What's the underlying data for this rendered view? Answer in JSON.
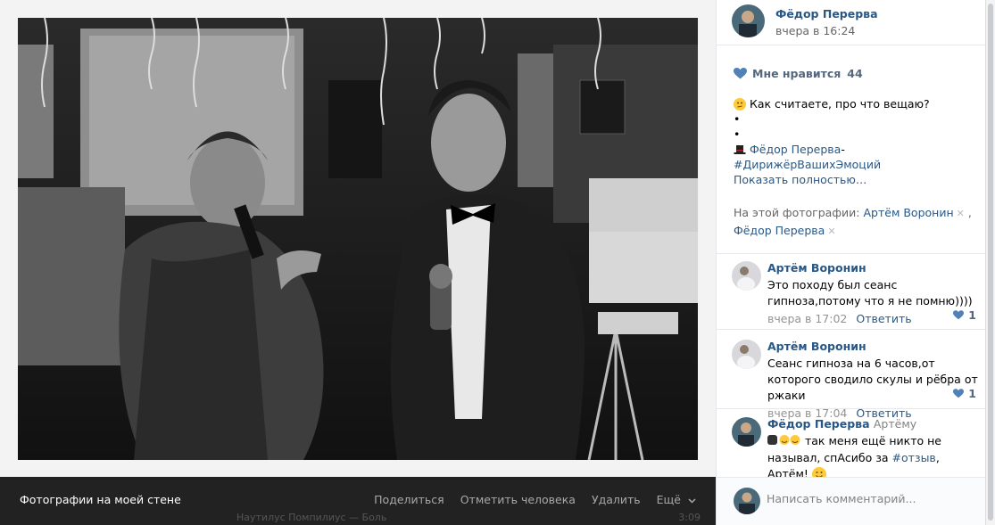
{
  "viewer": {
    "album_title": "Фотографии на моей стене",
    "actions": [
      "Поделиться",
      "Отметить человека",
      "Удалить",
      "Ещё"
    ],
    "background_strip": [
      "Наутилус Помпилиус — Боль",
      "3:09"
    ]
  },
  "post": {
    "author_name": "Фёдор Перерва",
    "time": "вчера в 16:24",
    "likes_label": "Мне нравится",
    "likes_count": "44",
    "text_line1": "Как считаете, про что вещаю?",
    "dot1": "•",
    "dot2": "•",
    "signature_name": "Фёдор Перерва",
    "signature_dash": " -",
    "hashtag": "#ДирижёрВашихЭмоций",
    "show_more": "Показать полностью…",
    "tags_label": "На этой фотографии:",
    "tag1": "Артём Воронин",
    "tag_sep": " ,",
    "tag2": "Фёдор Перерва"
  },
  "comments": [
    {
      "author": "Артём Воронин",
      "text": "Это походу был сеанс гипноза,потому что я не помню))))",
      "time": "вчера в 17:02",
      "reply": "Ответить",
      "likes": "1"
    },
    {
      "author": "Артём Воронин",
      "text": "Сеанс гипноза на 6 часов,от которого сводило скулы и рёбра от ржаки",
      "time": "вчера в 17:04",
      "reply": "Ответить",
      "likes": "1"
    },
    {
      "author": "Фёдор Перерва",
      "to": "Артёму",
      "text_before": "так меня ещё никто не называл, спАсибо за ",
      "hashtag": "#отзыв",
      "text_after": ", Артём!"
    }
  ],
  "comment_input": {
    "placeholder": "Написать комментарий..."
  },
  "colors": {
    "link": "#2a5885",
    "like_icon": "#5181b8",
    "viewer_bar": "#222222"
  },
  "icons": [
    "heart-icon",
    "thinking-emoji-icon",
    "top-hat-emoji-icon",
    "remove-tag-icon",
    "chevron-down-icon",
    "smile-emoji-icon"
  ]
}
